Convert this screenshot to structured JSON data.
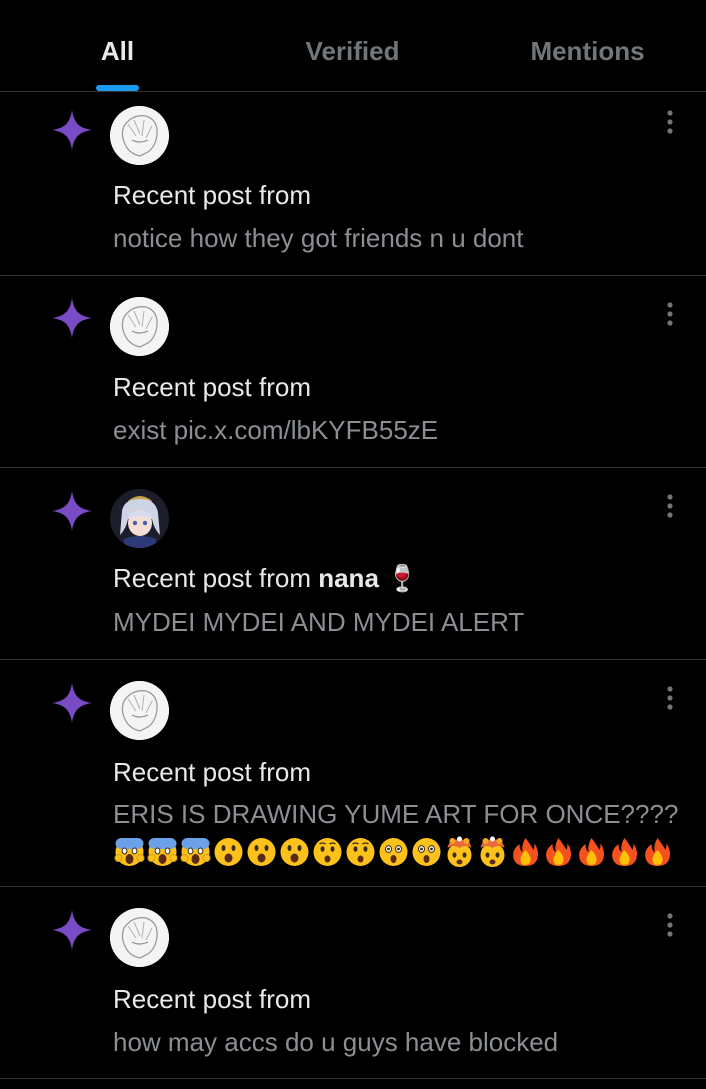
{
  "tabs": [
    {
      "label": "All",
      "active": true
    },
    {
      "label": "Verified",
      "active": false
    },
    {
      "label": "Mentions",
      "active": false
    }
  ],
  "colors": {
    "background": "#000000",
    "accent": "#1d9bf0",
    "sparkle": "#794bc4",
    "divider": "#2f3336",
    "muted_text": "#8b8f94"
  },
  "notifications": [
    {
      "icon": "sparkle-icon",
      "avatar": "sketch-avatar",
      "prefix": "Recent post from",
      "author": "",
      "text": "notice how they got friends n u dont"
    },
    {
      "icon": "sparkle-icon",
      "avatar": "sketch-avatar",
      "prefix": "Recent post from",
      "author": "",
      "text": "exist pic.x.com/lbKYFB55zE"
    },
    {
      "icon": "sparkle-icon",
      "avatar": "anime-girl-avatar",
      "prefix": "Recent post from",
      "author": "nana",
      "author_emoji": "🍷",
      "text": "MYDEI MYDEI AND MYDEI ALERT"
    },
    {
      "icon": "sparkle-icon",
      "avatar": "sketch-avatar",
      "prefix": "Recent post from",
      "author": "",
      "text": "ERIS IS DRAWING YUME ART FOR ONCE????",
      "emoji_line": [
        "😱",
        "😱",
        "😱",
        "😮",
        "😮",
        "😮",
        "😯",
        "😯",
        "😲",
        "😲",
        "🤯",
        "🤯",
        "🔥",
        "🔥",
        "🔥",
        "🔥",
        "🔥"
      ]
    },
    {
      "icon": "sparkle-icon",
      "avatar": "sketch-avatar",
      "prefix": "Recent post from",
      "author": "",
      "text": "how may accs do u guys have blocked"
    }
  ]
}
